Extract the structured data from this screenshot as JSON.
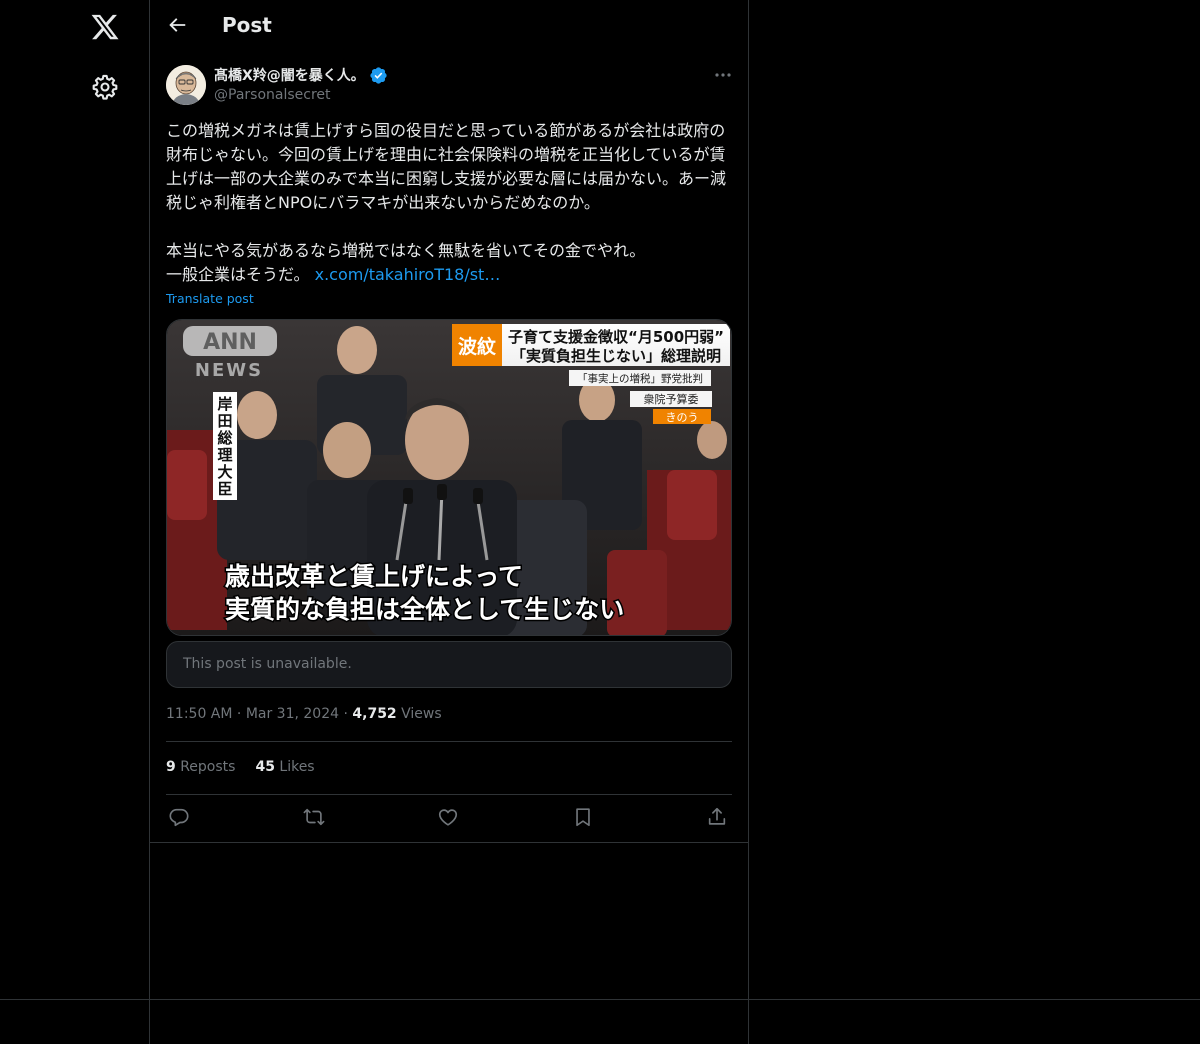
{
  "header": {
    "title": "Post"
  },
  "author": {
    "display_name": "髙橋X羚@闇を暴く人。",
    "handle": "@Parsonalsecret",
    "verified": true
  },
  "post": {
    "text": "この増税メガネは賃上げすら国の役目だと思っている節があるが会社は政府の財布じゃない。今回の賃上げを理由に社会保険料の増税を正当化しているが賃上げは一部の大企業のみで本当に困窮し支援が必要な層には届かない。あー減税じゃ利権者とNPOにバラマキが出来ないからだめなのか。\n\n本当にやる気があるなら増税ではなく無駄を省いてその金でやれ。\n一般企業はそうだ。 ",
    "link_text": "x.com/takahiroT18/st…",
    "translate_label": "Translate post",
    "time": "11:50 AM",
    "date": "Mar 31, 2024",
    "views_count": "4,752",
    "views_label": "Views",
    "reposts_count": "9",
    "reposts_label": "Reposts",
    "likes_count": "45",
    "likes_label": "Likes",
    "quote_unavailable": "This post is unavailable."
  },
  "media_overlay": {
    "logo": "ANN NEWS",
    "badge": "波紋",
    "headline_1": "子育て支援金徴収“月500円弱”",
    "headline_2": "「実質負担生じない」総理説明",
    "subnote": "「事実上の増税」野党批判",
    "committee": "衆院予算委",
    "when": "きのう",
    "speaker": "岸田総理大臣",
    "caption_1": "歳出改革と賃上げによって",
    "caption_2": "実質的な負担は全体として生じない"
  },
  "colors": {
    "accent": "#1d9bf0",
    "text_primary": "#e7e9ea",
    "text_secondary": "#71767b",
    "border": "#2f3336",
    "background": "#000000"
  },
  "icons": [
    "x-logo-icon",
    "gear-icon",
    "back-arrow-icon",
    "verified-badge-icon",
    "more-icon",
    "reply-icon",
    "repost-icon",
    "like-icon",
    "bookmark-icon",
    "share-icon"
  ]
}
